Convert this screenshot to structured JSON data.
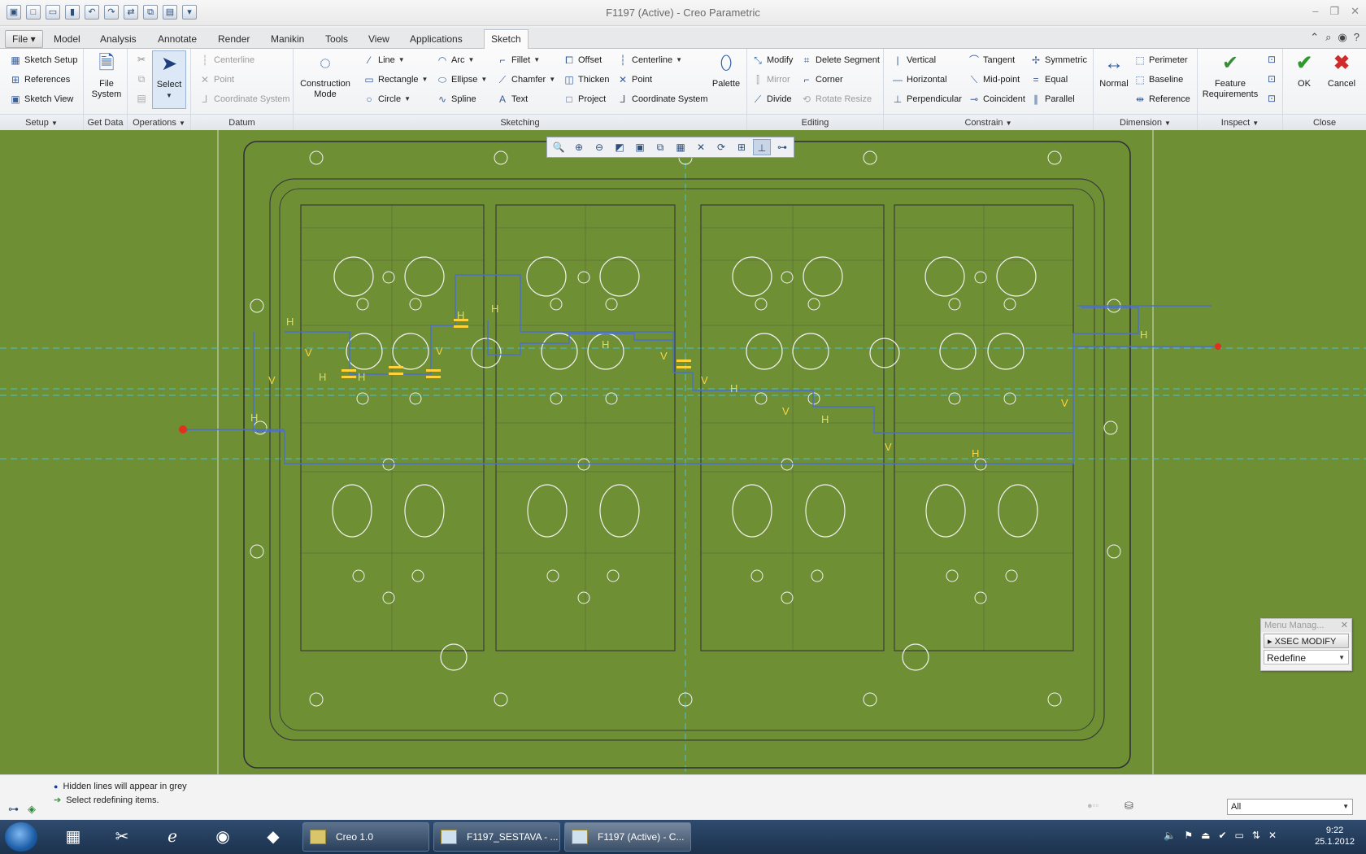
{
  "window": {
    "title": "F1197 (Active) - Creo Parametric",
    "controls": [
      "–",
      "❐",
      "✕"
    ]
  },
  "quick_access": [
    "▣",
    "□",
    "▭",
    "▮",
    "↶",
    "↷",
    "⇄",
    "⧉",
    "▤",
    "▾"
  ],
  "tabs": [
    {
      "label": "File ▾",
      "active": false
    },
    {
      "label": "Model",
      "active": false
    },
    {
      "label": "Analysis",
      "active": false
    },
    {
      "label": "Annotate",
      "active": false
    },
    {
      "label": "Render",
      "active": false
    },
    {
      "label": "Manikin",
      "active": false
    },
    {
      "label": "Tools",
      "active": false
    },
    {
      "label": "View",
      "active": false
    },
    {
      "label": "Applications",
      "active": false
    },
    {
      "label": "Sketch",
      "active": true
    }
  ],
  "ribbon": {
    "setup": {
      "label": "Setup",
      "sketch_setup": "Sketch Setup",
      "references": "References",
      "sketch_view": "Sketch View"
    },
    "get_data": {
      "label": "Get Data",
      "file_system": "File\nSystem"
    },
    "operations": {
      "label": "Operations",
      "select": "Select"
    },
    "datum": {
      "label": "Datum",
      "centerline": "Centerline",
      "point": "Point",
      "coordinate_system": "Coordinate System"
    },
    "sketching": {
      "label": "Sketching",
      "construction_mode": "Construction\nMode",
      "line": "Line",
      "rectangle": "Rectangle",
      "circle": "Circle",
      "arc": "Arc",
      "ellipse": "Ellipse",
      "spline": "Spline",
      "fillet": "Fillet",
      "chamfer": "Chamfer",
      "text": "Text",
      "offset": "Offset",
      "thicken": "Thicken",
      "project": "Project",
      "centerline": "Centerline",
      "point": "Point",
      "coordinate_system": "Coordinate System",
      "palette": "Palette"
    },
    "editing": {
      "label": "Editing",
      "modify": "Modify",
      "mirror": "Mirror",
      "divide": "Divide",
      "delete_segment": "Delete Segment",
      "corner": "Corner",
      "rotate_resize": "Rotate Resize"
    },
    "constrain": {
      "label": "Constrain",
      "vertical": "Vertical",
      "horizontal": "Horizontal",
      "perpendicular": "Perpendicular",
      "tangent": "Tangent",
      "midpoint": "Mid-point",
      "coincident": "Coincident",
      "symmetric": "Symmetric",
      "equal": "Equal",
      "parallel": "Parallel"
    },
    "dimension": {
      "label": "Dimension",
      "normal": "Normal",
      "perimeter": "Perimeter",
      "baseline": "Baseline",
      "reference": "Reference"
    },
    "inspect": {
      "label": "Inspect",
      "feature_requirements": "Feature\nRequirements"
    },
    "close": {
      "label": "Close",
      "ok": "OK",
      "cancel": "Cancel"
    }
  },
  "graphics_toolbar": [
    "🔍",
    "⊕",
    "⊖",
    "◩",
    "▣",
    "⧉",
    "▦",
    "✕",
    "⟳",
    "⊞",
    "⊥",
    "⊶"
  ],
  "menu_manager": {
    "title": "Menu Manag...",
    "item": "XSEC MODIFY",
    "selected": "Redefine"
  },
  "messages": [
    {
      "icon": "dot",
      "text": "Hidden lines will appear in grey"
    },
    {
      "icon": "arrow",
      "text": "Select redefining items."
    }
  ],
  "filter": {
    "value": "All"
  },
  "taskbar": {
    "items": [
      {
        "label": "Creo 1.0",
        "active": false
      },
      {
        "label": "F1197_SESTAVA - ...",
        "active": false
      },
      {
        "label": "F1197 (Active) - C...",
        "active": true
      }
    ],
    "time": "9:22",
    "date": "25.1.2012"
  },
  "colors": {
    "canvas_bg": "#6e8f34",
    "sketch_line": "#4a6fd6",
    "highlight": "#ffd23a",
    "geometry": "#2e2e3a"
  }
}
